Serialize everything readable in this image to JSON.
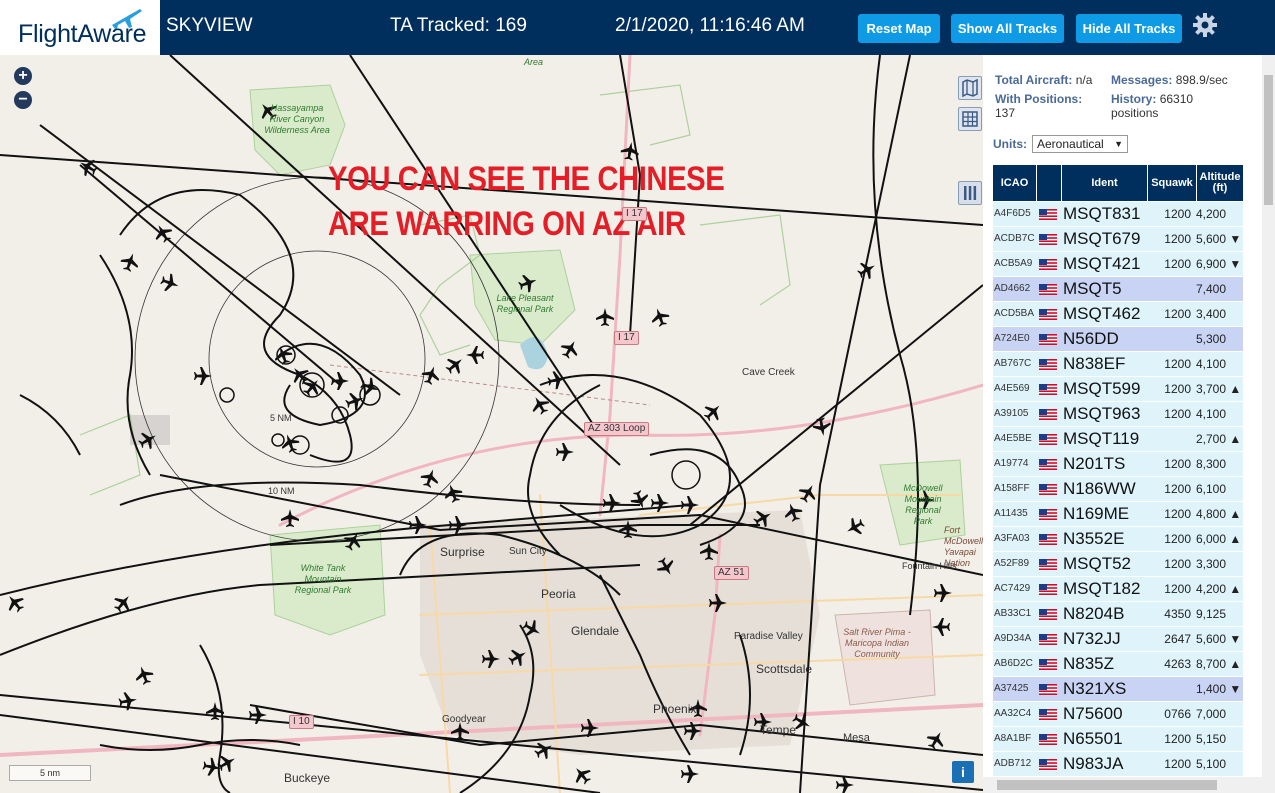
{
  "header": {
    "logo": "FlightAware",
    "site_name": "SKYVIEW",
    "tracked_label": "TA Tracked: 169",
    "datetime": "2/1/2020, 11:16:46 AM",
    "buttons": {
      "reset": "Reset Map",
      "show_all": "Show All Tracks",
      "hide_all": "Hide All Tracks"
    },
    "accent_color": "#0e9ae4",
    "bar_color": "#002f5d"
  },
  "map": {
    "overlay_line1": "YOU CAN SEE THE CHINESE",
    "overlay_line2": "ARE WARRING ON AZ AIR",
    "zoom_in": "+",
    "zoom_out": "−",
    "scale": "5 nm",
    "info": "i",
    "range_5": "5 NM",
    "range_10": "10 NM",
    "places": {
      "surprise": "Surprise",
      "sun_city": "Sun City",
      "peoria": "Peoria",
      "glendale": "Glendale",
      "paradise_valley": "Paradise Valley",
      "scottsdale": "Scottsdale",
      "phoenix": "Phoenix",
      "tempe": "Tempe",
      "mesa": "Mesa",
      "goodyear": "Goodyear",
      "buckeye": "Buckeye",
      "cave_creek": "Cave Creek",
      "fountain_hills": "Fountain Hills",
      "fort_mcdowell": "Fort McDowell Yavapai Nation",
      "area": "Area"
    },
    "parks": {
      "hassayampa": "Hassayampa River Canyon Wilderness Area",
      "lake_pleasant": "Lake Pleasant Regional Park",
      "white_tank": "White Tank Mountain Regional Park",
      "mcdowell": "McDowell Mountain Regional Park",
      "salt_river": "Salt River Pima - Maricopa Indian Community"
    },
    "roads": {
      "i17_a": "I 17",
      "i17_b": "I 17",
      "loop303": "AZ 303 Loop",
      "az51": "AZ 51",
      "i10": "I 10"
    }
  },
  "sidebar": {
    "total_aircraft_label": "Total Aircraft:",
    "total_aircraft_value": "n/a",
    "messages_label": "Messages:",
    "messages_value": "898.9/sec",
    "positions_label": "With Positions:",
    "positions_value": "137",
    "history_label": "History:",
    "history_value": "66310 positions",
    "units_label": "Units:",
    "units_value": "Aeronautical",
    "columns": {
      "icao": "ICAO",
      "ident": "Ident",
      "squawk": "Squawk",
      "altitude_1": "Altitude",
      "altitude_2": "(ft)"
    },
    "rows": [
      {
        "icao": "A4F6D5",
        "ident": "MSQT831",
        "squawk": "1200",
        "alt": "4,200",
        "hl": false
      },
      {
        "icao": "ACDB7C",
        "ident": "MSQT679",
        "squawk": "1200",
        "alt": "5,600 ▼",
        "hl": false
      },
      {
        "icao": "ACB5A9",
        "ident": "MSQT421",
        "squawk": "1200",
        "alt": "6,900 ▼",
        "hl": false
      },
      {
        "icao": "AD4662",
        "ident": "MSQT5",
        "squawk": "",
        "alt": "7,400",
        "hl": true
      },
      {
        "icao": "ACD5BA",
        "ident": "MSQT462",
        "squawk": "1200",
        "alt": "3,400",
        "hl": false
      },
      {
        "icao": "A724E0",
        "ident": "N56DD",
        "squawk": "",
        "alt": "5,300",
        "hl": true
      },
      {
        "icao": "AB767C",
        "ident": "N838EF",
        "squawk": "1200",
        "alt": "4,100",
        "hl": false
      },
      {
        "icao": "A4E569",
        "ident": "MSQT599",
        "squawk": "1200",
        "alt": "3,700 ▲",
        "hl": false
      },
      {
        "icao": "A39105",
        "ident": "MSQT963",
        "squawk": "1200",
        "alt": "4,100",
        "hl": false
      },
      {
        "icao": "A4E5BE",
        "ident": "MSQT119",
        "squawk": "",
        "alt": "2,700 ▲",
        "hl": false
      },
      {
        "icao": "A19774",
        "ident": "N201TS",
        "squawk": "1200",
        "alt": "8,300",
        "hl": false
      },
      {
        "icao": "A158FF",
        "ident": "N186WW",
        "squawk": "1200",
        "alt": "6,100",
        "hl": false
      },
      {
        "icao": "A11435",
        "ident": "N169ME",
        "squawk": "1200",
        "alt": "4,800 ▲",
        "hl": false
      },
      {
        "icao": "A3FA03",
        "ident": "N3552E",
        "squawk": "1200",
        "alt": "6,000 ▲",
        "hl": false
      },
      {
        "icao": "A52F89",
        "ident": "MSQT52",
        "squawk": "1200",
        "alt": "3,300",
        "hl": false
      },
      {
        "icao": "AC7429",
        "ident": "MSQT182",
        "squawk": "1200",
        "alt": "4,200 ▲",
        "hl": false
      },
      {
        "icao": "AB33C1",
        "ident": "N8204B",
        "squawk": "4350",
        "alt": "9,125",
        "hl": false
      },
      {
        "icao": "A9D34A",
        "ident": "N732JJ",
        "squawk": "2647",
        "alt": "5,600 ▼",
        "hl": false
      },
      {
        "icao": "AB6D2C",
        "ident": "N835Z",
        "squawk": "4263",
        "alt": "8,700 ▲",
        "hl": false
      },
      {
        "icao": "A37425",
        "ident": "N321XS",
        "squawk": "",
        "alt": "1,400 ▼",
        "hl": true
      },
      {
        "icao": "AA32C4",
        "ident": "N75600",
        "squawk": "0766",
        "alt": "7,000",
        "hl": false
      },
      {
        "icao": "A8A1BF",
        "ident": "N65501",
        "squawk": "1200",
        "alt": "5,150",
        "hl": false
      },
      {
        "icao": "ADB712",
        "ident": "N983JA",
        "squawk": "1200",
        "alt": "5,100",
        "hl": false
      }
    ],
    "row_colors": {
      "normal": "#dff3fb",
      "highlight": "#c9d3f4"
    }
  }
}
